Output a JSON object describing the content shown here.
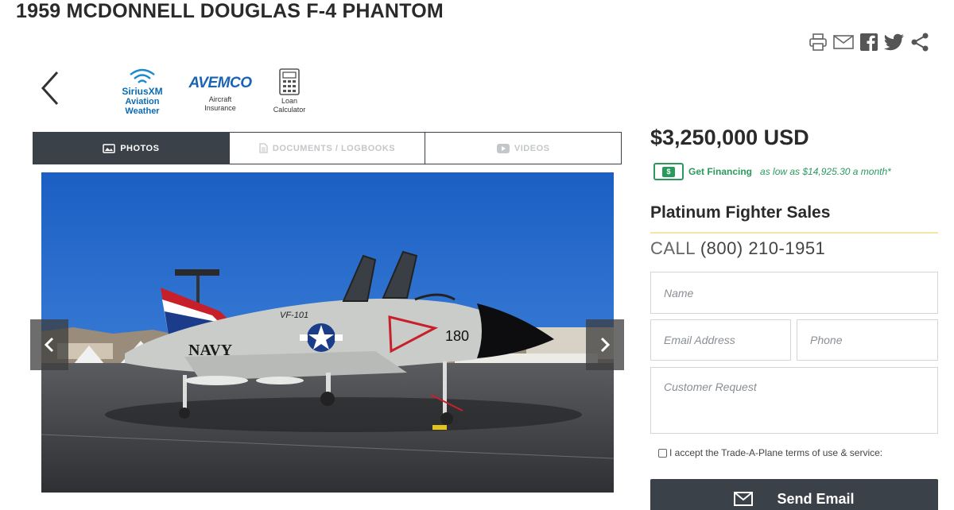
{
  "listing": {
    "title": "1959 MCDONNELL DOUGLAS F-4 PHANTOM",
    "price": "$3,250,000 USD"
  },
  "share_icons": [
    "printer-icon",
    "email-icon",
    "facebook-icon",
    "twitter-icon",
    "share-icon"
  ],
  "partners": {
    "sirius": {
      "logo": "SiriusXM",
      "caption_1": "Aviation",
      "caption_2": "Weather"
    },
    "avemco": {
      "logo": "AVEMCO",
      "caption_1": "Aircraft",
      "caption_2": "Insurance"
    },
    "loan": {
      "caption_1": "Loan",
      "caption_2": "Calculator"
    }
  },
  "tabs": [
    {
      "label": "PHOTOS",
      "icon": "photo-icon"
    },
    {
      "label": "DOCUMENTS / LOGBOOKS",
      "icon": "document-icon"
    },
    {
      "label": "VIDEOS",
      "icon": "video-icon"
    }
  ],
  "financing": {
    "badge": "$",
    "link": "Get Financing",
    "text": "as low as $14,925.30 a month*"
  },
  "dealer": {
    "name": "Platinum Fighter Sales",
    "call_label": "CALL",
    "phone": "(800) 210-1951"
  },
  "form": {
    "name_placeholder": "Name",
    "email_placeholder": "Email Address",
    "phone_placeholder": "Phone",
    "request_placeholder": "Customer Request",
    "terms": "I accept the Trade-A-Plane terms of use & service:",
    "send_label": "Send Email"
  },
  "aircraft_markings": {
    "squadron": "VF-101",
    "number": "180",
    "service": "NAVY"
  },
  "colors": {
    "dark": "#3b4148",
    "green": "#2a9a5c",
    "sky": "#1f68c9"
  }
}
